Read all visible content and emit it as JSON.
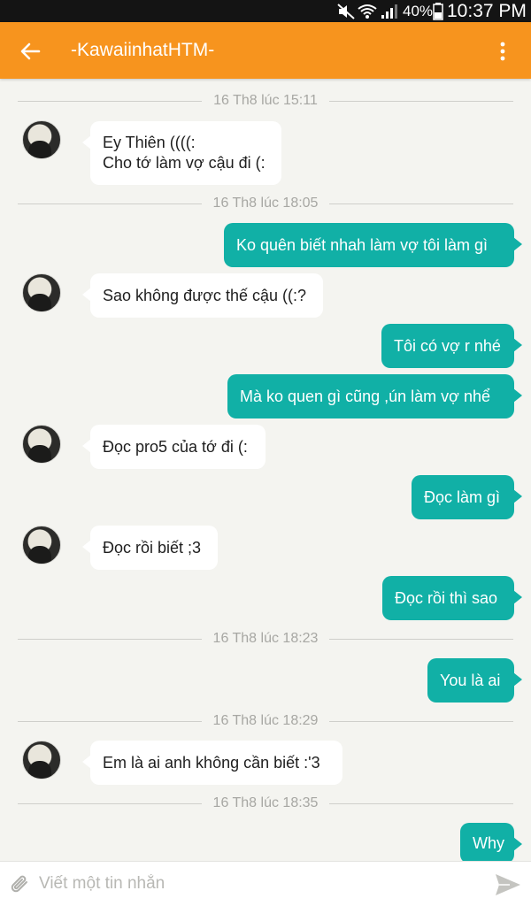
{
  "status_bar": {
    "battery_percent": "40%",
    "time": "10:37 PM",
    "icons": [
      "mute-icon",
      "wifi-icon",
      "signal-icon",
      "battery-icon"
    ]
  },
  "header": {
    "back_icon": "arrow-left-icon",
    "title": "-KawaiinhatHTM-",
    "menu_icon": "more-vert-icon",
    "color": "#f7941e"
  },
  "colors": {
    "outgoing_bubble": "#11b0a6",
    "incoming_bubble": "#ffffff",
    "background": "#f4f4f0"
  },
  "messages": {
    "sep1": "16 Th8 lúc 15:11",
    "in1_line1": "Ey Thiên ((((:",
    "in1_line2": "Cho tớ làm vợ cậu đi (:",
    "sep2": "16 Th8 lúc 18:05",
    "out1": "Ko quên biết nhah làm vợ tôi làm gì",
    "in2": "Sao không được thế cậu ((:?",
    "out2": "Tôi có vợ r nhé",
    "out3": "Mà ko quen gì cũng ,ún làm vợ nhể",
    "in3": "Đọc pro5 của tớ đi (:",
    "out4": "Đọc làm gì",
    "in4": "Đọc rồi biết ;3",
    "out5": "Đọc rồi thì sao",
    "sep3": "16 Th8 lúc 18:23",
    "out6": "You là ai",
    "sep4": "16 Th8 lúc 18:29",
    "in5": "Em là ai anh không cần biết :'3",
    "sep5": "16 Th8 lúc 18:35",
    "out7": "Why"
  },
  "composer": {
    "placeholder": "Viết một tin nhắn",
    "attach_icon": "paperclip-icon",
    "send_icon": "send-icon"
  }
}
